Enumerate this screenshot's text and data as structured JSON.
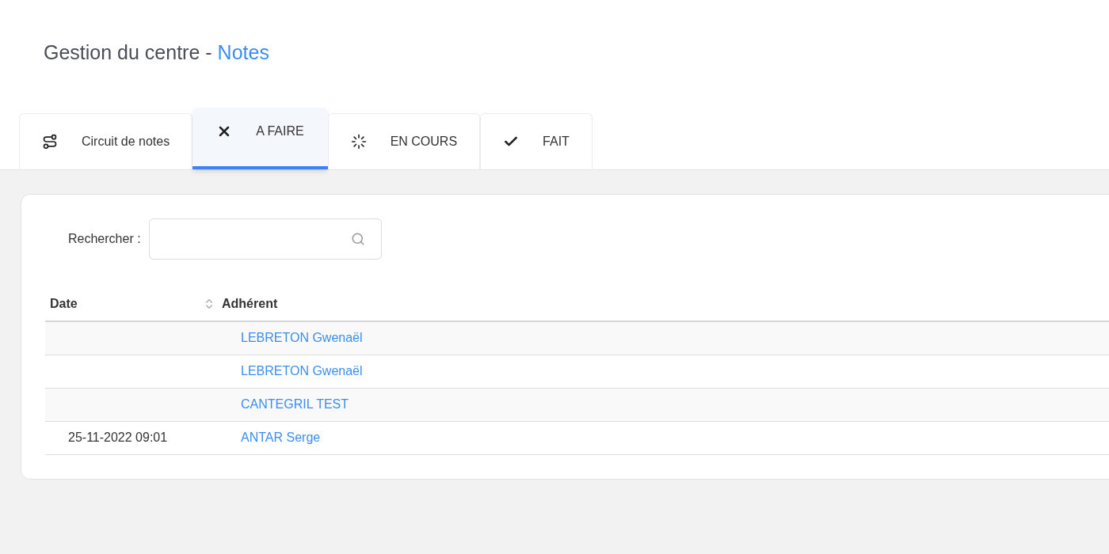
{
  "page_title": {
    "prefix": "Gestion du centre -",
    "section": "Notes"
  },
  "tabs": [
    {
      "label": "Circuit de notes",
      "kind": "route",
      "selected": false
    },
    {
      "label": "A FAIRE",
      "kind": "cross",
      "selected": true
    },
    {
      "label": "EN COURS",
      "kind": "spinner",
      "selected": false
    },
    {
      "label": "FAIT",
      "kind": "check",
      "selected": false
    }
  ],
  "search": {
    "label": "Rechercher :"
  },
  "table": {
    "columns": [
      "Date",
      "Adhérent"
    ],
    "rows": [
      {
        "member": "LEBRETON Gwenaël"
      },
      {
        "member": "LEBRETON Gwenaël"
      },
      {
        "member": "CANTEGRIL TEST"
      },
      {
        "date": "25-11-2022 09:01",
        "member": "ANTAR Serge"
      }
    ]
  }
}
